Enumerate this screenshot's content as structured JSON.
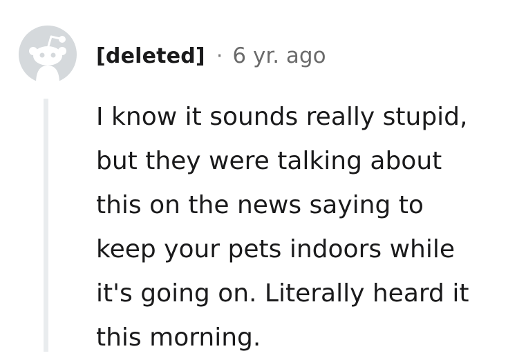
{
  "comment": {
    "author": "[deleted]",
    "separator": "·",
    "time": "6 yr. ago",
    "body_lines": [
      "I know it sounds really stupid,",
      "but they were talking about",
      "this on the news saying to",
      "keep your pets indoors while",
      "it's going on. Literally heard it",
      "this morning."
    ],
    "avatar_icon": "default-snoo-avatar-icon"
  },
  "colors": {
    "avatar_bg": "#d5d9dc",
    "thread_line": "#e9ecee",
    "text": "#1a1a1b",
    "meta": "#6a6a6a"
  }
}
